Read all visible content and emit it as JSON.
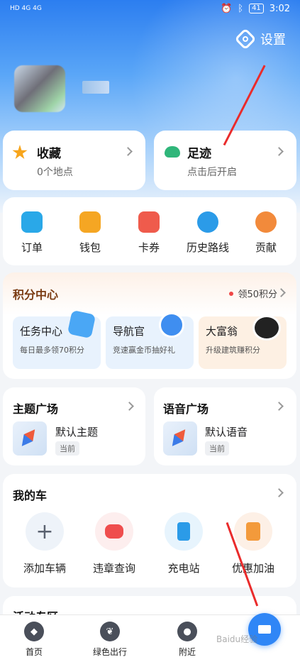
{
  "status_bar": {
    "left": "HD 4G 4G",
    "time": "3:02",
    "battery": "41"
  },
  "header": {
    "settings_label": "设置"
  },
  "favorites": {
    "title": "收藏",
    "subtitle": "0个地点"
  },
  "footprint": {
    "title": "足迹",
    "subtitle": "点击后开启"
  },
  "quick_actions": [
    {
      "label": "订单",
      "icon": "order-icon",
      "color": "#2aa8e8"
    },
    {
      "label": "钱包",
      "icon": "wallet-icon",
      "color": "#f5a623"
    },
    {
      "label": "卡券",
      "icon": "coupon-icon",
      "color": "#ef5b4c"
    },
    {
      "label": "历史路线",
      "icon": "route-icon",
      "color": "#2b9be8"
    },
    {
      "label": "贡献",
      "icon": "contribute-icon",
      "color": "#f28a3b"
    }
  ],
  "points": {
    "title": "积分中心",
    "claim_label": "领50积分",
    "tiles": [
      {
        "title": "任务中心",
        "subtitle": "每日最多领70积分",
        "icon": "checkmark-icon",
        "color": "#e8f2fd"
      },
      {
        "title": "导航官",
        "subtitle": "竞速赢金币抽好礼",
        "icon": "compass-icon",
        "color": "#e8f2fd"
      },
      {
        "title": "大富翁",
        "subtitle": "升级建筑赚积分",
        "icon": "penguin-icon",
        "color": "#fdf0e3"
      }
    ]
  },
  "theme_square": {
    "title": "主题广场",
    "item": "默认主题",
    "tag": "当前"
  },
  "voice_square": {
    "title": "语音广场",
    "item": "默认语音",
    "tag": "当前"
  },
  "my_car": {
    "title": "我的车",
    "items": [
      {
        "label": "添加车辆",
        "icon": "plus-icon",
        "color": "#eef3f9"
      },
      {
        "label": "违章查询",
        "icon": "violation-icon",
        "color": "#fdeeee"
      },
      {
        "label": "充电站",
        "icon": "charging-icon",
        "color": "#e7f4fd"
      },
      {
        "label": "优惠加油",
        "icon": "fuel-icon",
        "color": "#fdf0e6"
      }
    ]
  },
  "activity": {
    "title": "活动专区"
  },
  "bottom_nav": [
    {
      "label": "首页",
      "icon": "home-compass-icon"
    },
    {
      "label": "绿色出行",
      "icon": "leaf-icon"
    },
    {
      "label": "附近",
      "icon": "location-icon"
    }
  ],
  "watermark": "Baidu经验"
}
